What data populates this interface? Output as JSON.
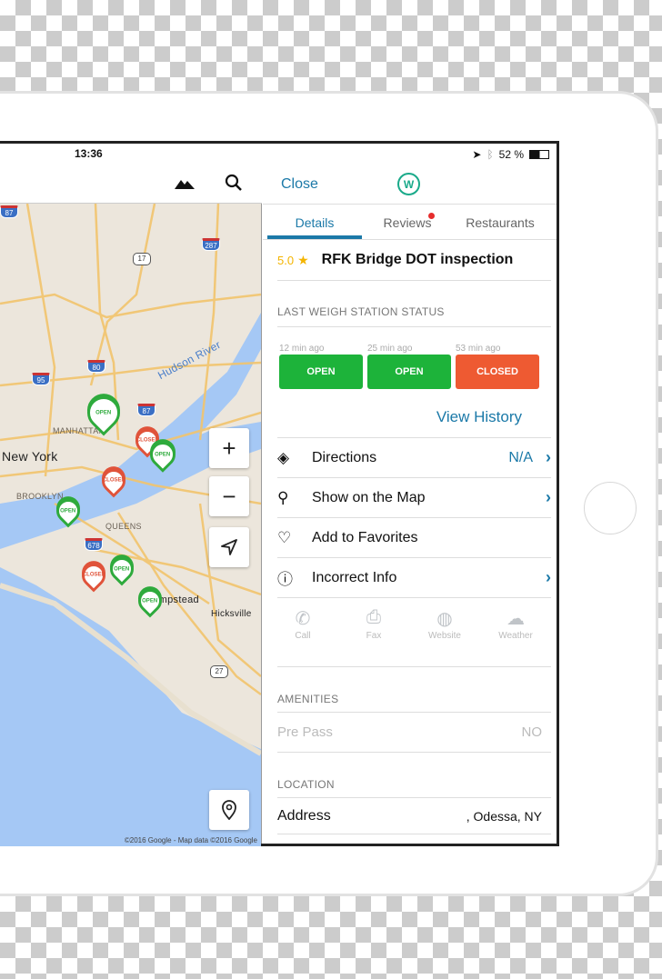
{
  "map_panel": {
    "time": "13:36",
    "icons": [
      "terrain-icon",
      "search-icon"
    ],
    "labels": {
      "new_york": "New York",
      "manhattan": "MANHATTAN",
      "brooklyn": "BROOKLYN",
      "queens": "QUEENS",
      "hudson": "Hudson River",
      "hempstead": "Hempstead",
      "hicksville": "Hicksville"
    },
    "shields": [
      "87",
      "287",
      "17",
      "80",
      "95",
      "87",
      "678",
      "27"
    ],
    "markers": [
      {
        "status": "OPEN",
        "color": "#2eaa3c"
      },
      {
        "status": "CLOSED",
        "color": "#e0533a"
      },
      {
        "status": "OPEN",
        "color": "#2eaa3c"
      },
      {
        "status": "CLOSED",
        "color": "#e0533a"
      },
      {
        "status": "OPEN",
        "color": "#2eaa3c"
      },
      {
        "status": "CLOSED",
        "color": "#e0533a"
      },
      {
        "status": "OPEN",
        "color": "#2eaa3c"
      },
      {
        "status": "OPEN",
        "color": "#2eaa3c"
      }
    ],
    "controls": {
      "zoom_in": "+",
      "zoom_out": "−"
    },
    "copyright": "©2016 Google - Map data ©2016 Google"
  },
  "detail_panel": {
    "status_bar": {
      "battery": "52 %"
    },
    "close": "Close",
    "logo": "W",
    "tabs": [
      {
        "label": "Details",
        "active": true
      },
      {
        "label": "Reviews",
        "badge": true
      },
      {
        "label": "Restaurants"
      }
    ],
    "rating": "5.0",
    "title": "RFK Bridge DOT inspection",
    "status_section": "LAST WEIGH STATION STATUS",
    "statuses": [
      {
        "ago": "12 min ago",
        "label": "OPEN",
        "color": "#1db33a"
      },
      {
        "ago": "25 min ago",
        "label": "OPEN",
        "color": "#1db33a"
      },
      {
        "ago": "53 min ago",
        "label": "CLOSED",
        "color": "#ee5a32"
      }
    ],
    "view_history": "View History",
    "actions": [
      {
        "label": "Directions",
        "value": "N/A",
        "icon": "directions-icon"
      },
      {
        "label": "Show on the Map",
        "value": "",
        "icon": "map-pin-icon"
      },
      {
        "label": "Add to Favorites",
        "value": "",
        "icon": "heart-icon"
      },
      {
        "label": "Incorrect Info",
        "value": "",
        "icon": "info-icon"
      }
    ],
    "contact": [
      {
        "label": "Call",
        "icon": "phone-icon"
      },
      {
        "label": "Fax",
        "icon": "printer-icon"
      },
      {
        "label": "Website",
        "icon": "globe-icon"
      },
      {
        "label": "Weather",
        "icon": "cloud-icon"
      }
    ],
    "amenities_section": "AMENITIES",
    "amenities": [
      {
        "label": "Pre Pass",
        "value": "NO"
      }
    ],
    "location_section": "LOCATION",
    "address_label": "Address",
    "address_value": ", Odessa, NY"
  },
  "colors": {
    "accent": "#1b79a8",
    "open": "#1db33a",
    "closed": "#ee5a32"
  }
}
